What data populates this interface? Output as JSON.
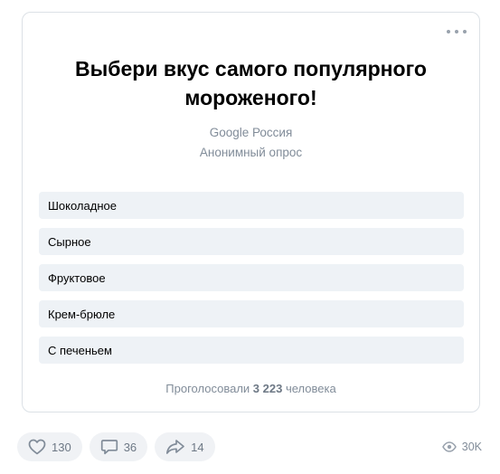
{
  "poll": {
    "title": "Выбери вкус самого популярного мороженого!",
    "author": "Google Россия",
    "type": "Анонимный опрос",
    "options": [
      {
        "label": "Шоколадное"
      },
      {
        "label": "Сырное"
      },
      {
        "label": "Фруктовое"
      },
      {
        "label": "Крем-брюле"
      },
      {
        "label": "С печеньем"
      }
    ],
    "votes_prefix": "Проголосовали",
    "votes_count": "3 223",
    "votes_suffix": "человека",
    "more_icon": "more-horizontal-icon"
  },
  "actions": {
    "likes": "130",
    "comments": "36",
    "shares": "14",
    "views": "30K",
    "icons": {
      "like": "heart-icon",
      "comment": "comment-icon",
      "share": "share-icon",
      "views": "eye-icon"
    }
  },
  "colors": {
    "option_bg": "#eef2f6",
    "muted_text": "#818c99",
    "border": "#dce1e6"
  }
}
